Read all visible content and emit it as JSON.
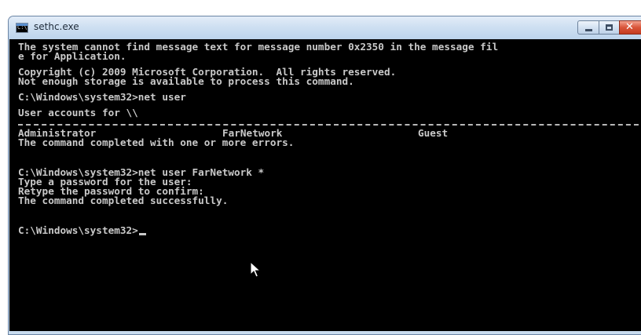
{
  "window": {
    "title": "sethc.exe",
    "icon": "console-app-icon",
    "icon_glyph": "C:\\",
    "close_glyph": "✕"
  },
  "console": {
    "line1": "The system cannot find message text for message number 0x2350 in the message fil",
    "line2": "e for Application.",
    "line3": "Copyright (c) 2009 Microsoft Corporation.  All rights reserved.",
    "line4": "Not enough storage is available to process this command.",
    "line5": "C:\\Windows\\system32>net user",
    "line6": "User accounts for \\\\",
    "accounts": [
      "Administrator",
      "FarNetwork",
      "Guest"
    ],
    "line8": "The command completed with one or more errors.",
    "line9": "C:\\Windows\\system32>net user FarNetwork *",
    "line10": "Type a password for the user:",
    "line11": "Retype the password to confirm:",
    "line12": "The command completed successfully.",
    "prompt": "C:\\Windows\\system32>"
  },
  "colors": {
    "console_bg": "#000000",
    "console_text": "#c9c9c9",
    "close_button": "#c43b1f"
  }
}
